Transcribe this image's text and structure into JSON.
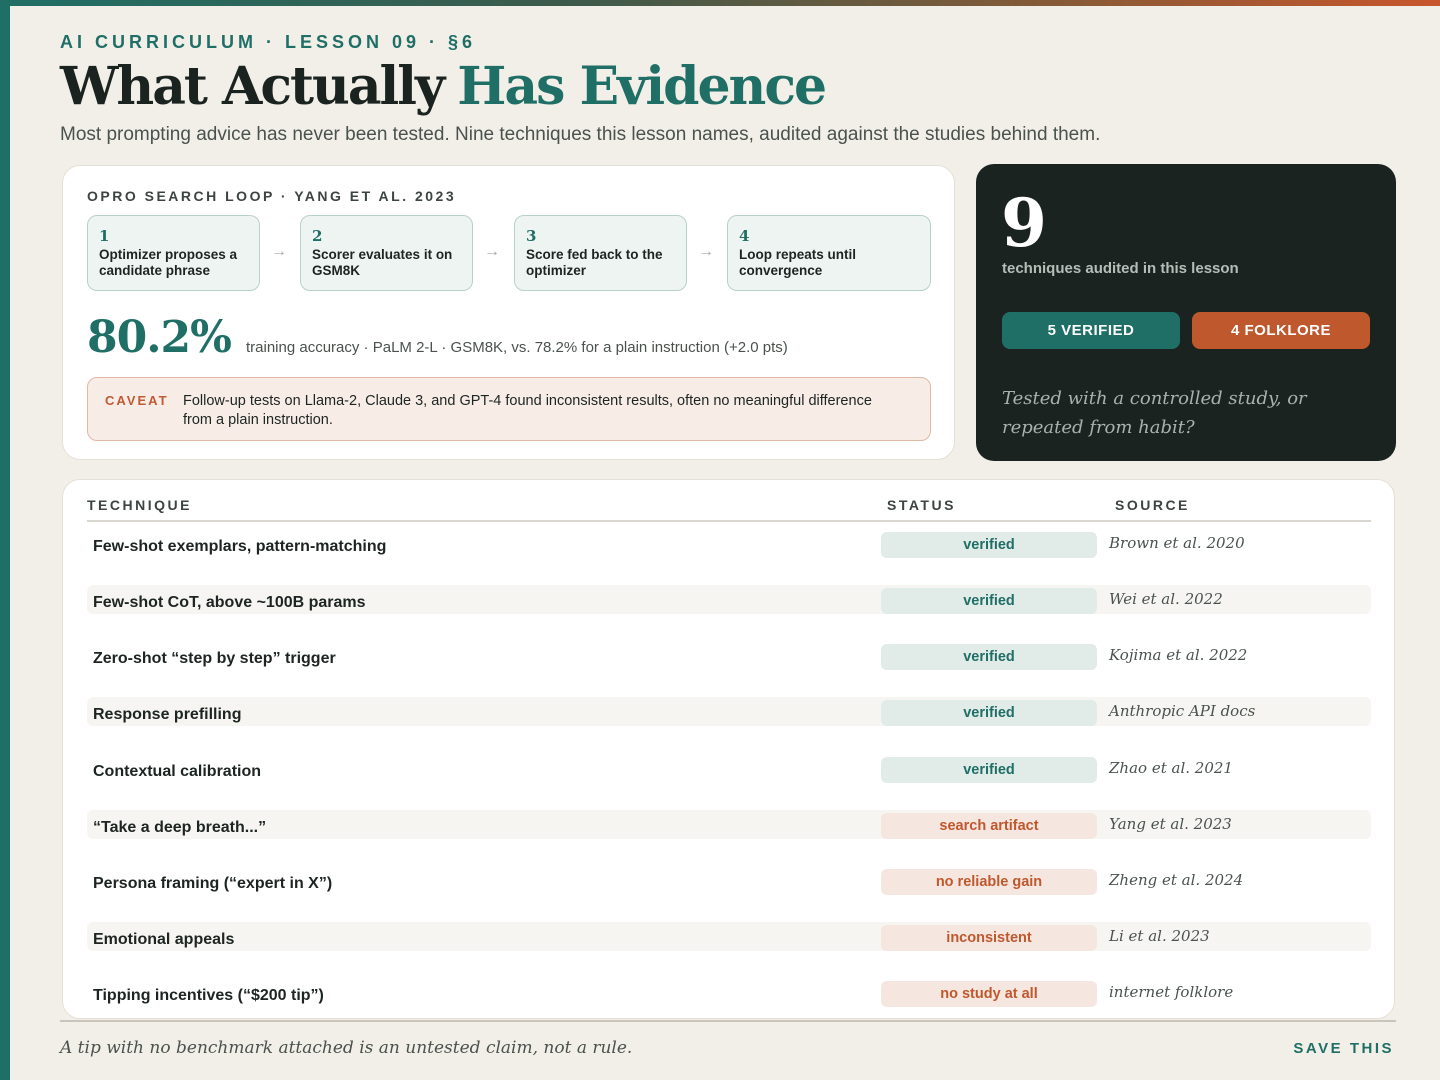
{
  "header": {
    "eyebrow": "AI CURRICULUM · LESSON 09 · §6",
    "title_part1": "What Actually",
    "title_part2": "Has Evidence",
    "subtitle": "Most prompting advice has never been tested. Nine techniques this lesson names, audited against the studies behind them."
  },
  "opro": {
    "label": "OPRO SEARCH LOOP · YANG ET AL. 2023",
    "steps": [
      {
        "num": "1",
        "text": "Optimizer proposes a candidate phrase"
      },
      {
        "num": "2",
        "text": "Scorer evaluates it on GSM8K"
      },
      {
        "num": "3",
        "text": "Score fed back to the optimizer"
      },
      {
        "num": "4",
        "text": "Loop repeats until convergence"
      }
    ],
    "arrow": "→",
    "stat": "80.2%",
    "stat_desc": "training accuracy · PaLM 2-L · GSM8K, vs. 78.2% for a plain instruction (+2.0 pts)",
    "caveat_tag": "CAVEAT",
    "caveat_text": "Follow-up tests on Llama-2, Claude 3, and GPT-4 found inconsistent results, often no meaningful difference from a plain instruction."
  },
  "summary": {
    "count": "9",
    "count_label": "techniques audited in this lesson",
    "verified_label": "5 VERIFIED",
    "folklore_label": "4 FOLKLORE",
    "quote": "Tested with a controlled study, or repeated from habit?"
  },
  "table": {
    "headers": {
      "technique": "TECHNIQUE",
      "status": "STATUS",
      "source": "SOURCE"
    },
    "rows": [
      {
        "technique": "Few-shot exemplars, pattern-matching",
        "status": "verified",
        "source": "Brown et al. 2020"
      },
      {
        "technique": "Few-shot CoT, above ~100B params",
        "status": "verified",
        "source": "Wei et al. 2022"
      },
      {
        "technique": "Zero-shot “step by step” trigger",
        "status": "verified",
        "source": "Kojima et al. 2022"
      },
      {
        "technique": "Response prefilling",
        "status": "verified",
        "source": "Anthropic API docs"
      },
      {
        "technique": "Contextual calibration",
        "status": "verified",
        "source": "Zhao et al. 2021"
      },
      {
        "technique": "“Take a deep breath...”",
        "status": "search artifact",
        "source": "Yang et al. 2023"
      },
      {
        "technique": "Persona framing (“expert in X”)",
        "status": "no reliable gain",
        "source": "Zheng et al. 2024"
      },
      {
        "technique": "Emotional appeals",
        "status": "inconsistent",
        "source": "Li et al. 2023"
      },
      {
        "technique": "Tipping incentives (“$200 tip”)",
        "status": "no study at all",
        "source": "internet folklore"
      }
    ]
  },
  "footer": {
    "quote": "A tip with no benchmark attached is an untested claim, not a rule.",
    "save_label": "SAVE THIS"
  },
  "colors": {
    "accent": "#1f6f66",
    "folklore": "#c0582d",
    "dark": "#1b2321",
    "background": "#f2efe8"
  }
}
